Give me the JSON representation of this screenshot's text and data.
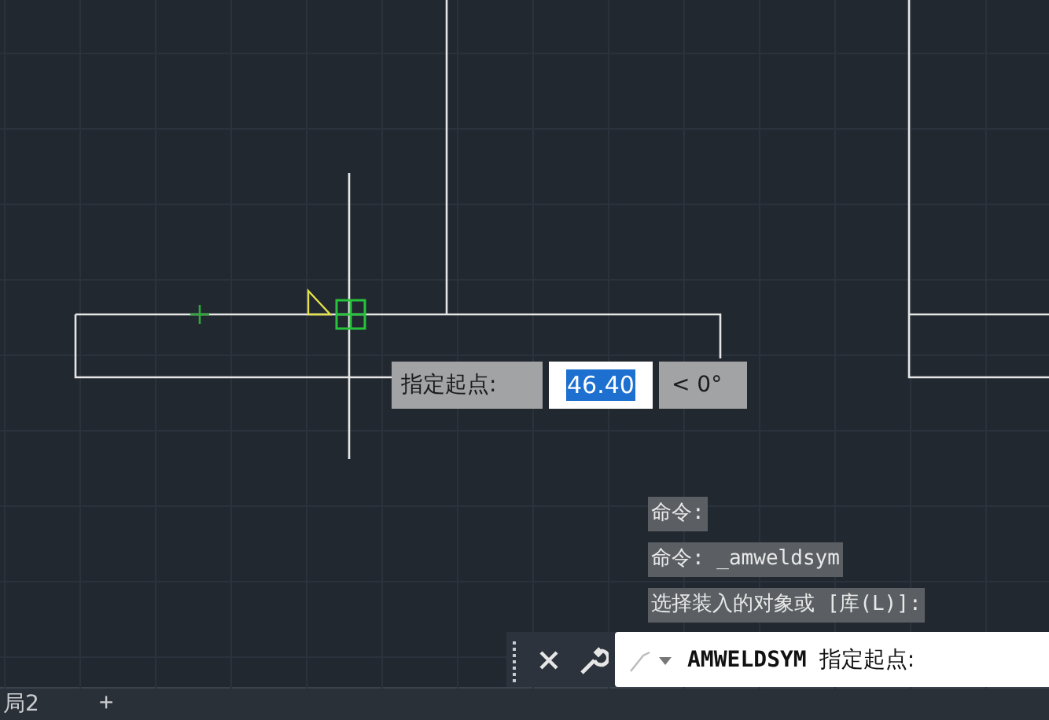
{
  "dynamic_input": {
    "label": "指定起点:",
    "value": "46.40",
    "angle": "< 0°"
  },
  "command_history": [
    "命令:",
    "命令: _amweldsym",
    "选择装入的对象或 [库(L)]:"
  ],
  "command_line": {
    "command": "AMWELDSYM",
    "prompt": "指定起点:"
  },
  "layout_tabs": [
    {
      "label": "局2",
      "selected": false
    }
  ],
  "add_tab": "+"
}
